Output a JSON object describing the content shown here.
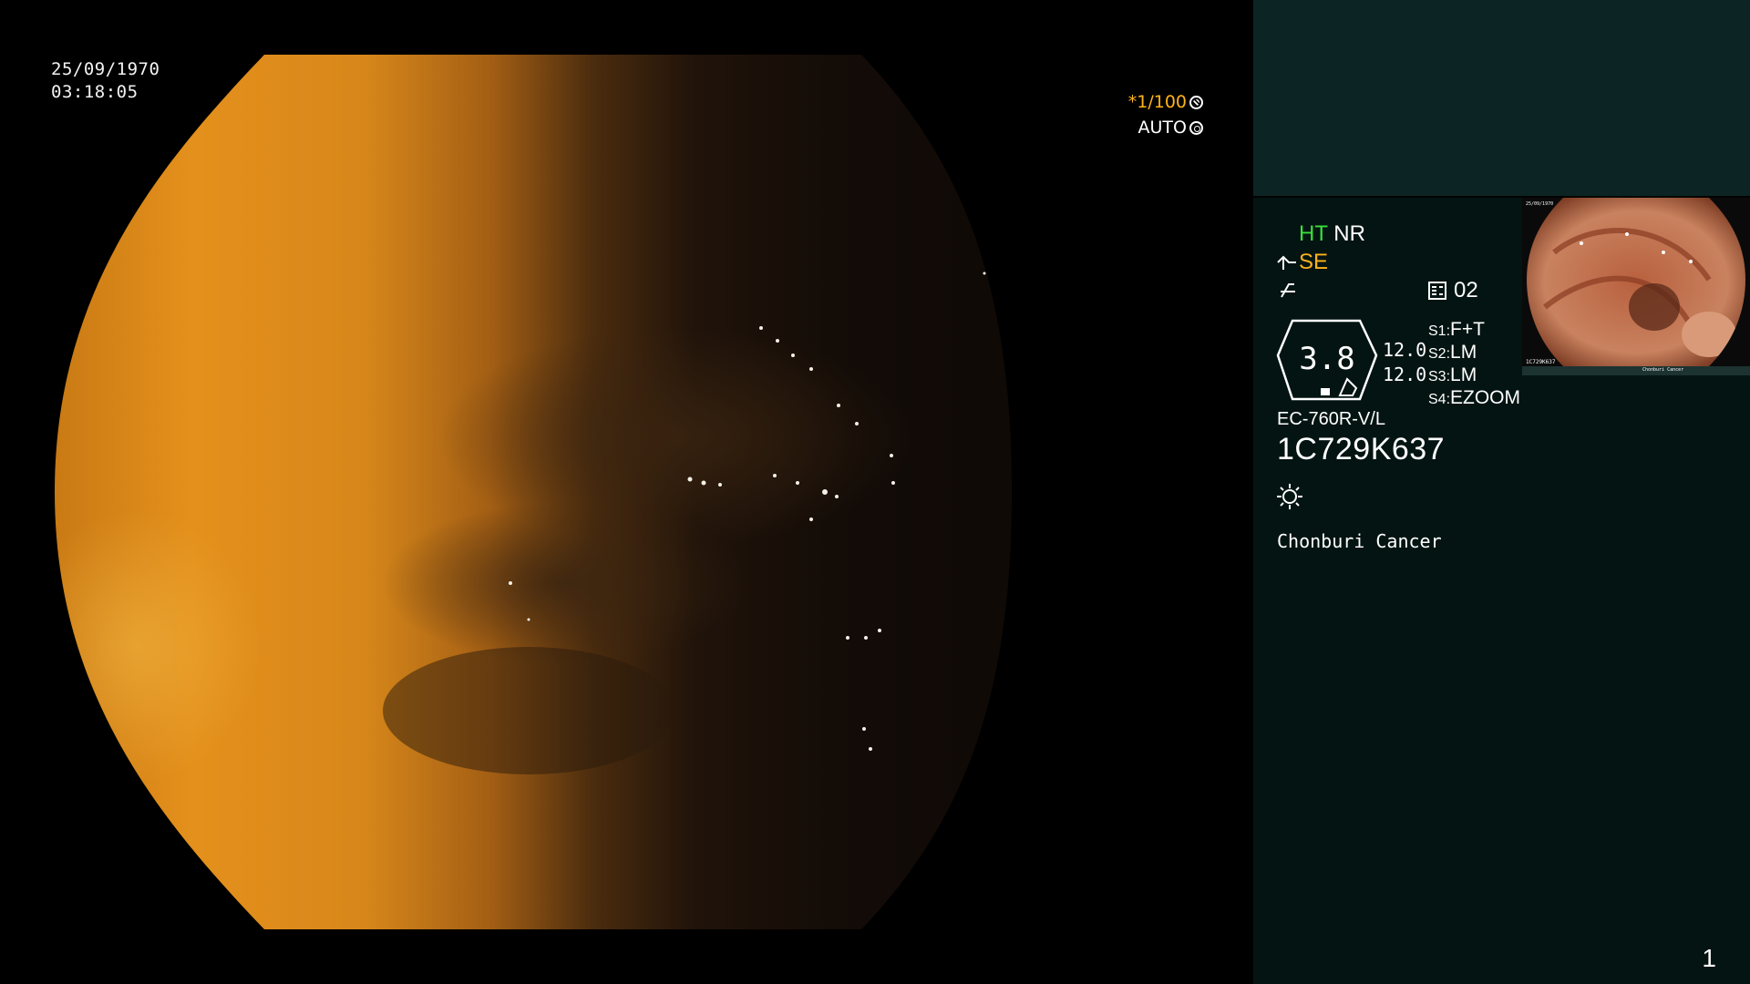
{
  "overlay": {
    "date": "25/09/1970",
    "time": "03:18:05",
    "shutter": "*1/100",
    "iris_mode": "AUTO",
    "page": "1"
  },
  "panel": {
    "ht": "HT",
    "nr": "NR",
    "se": "SE",
    "memory": "02",
    "magnification": "3.8",
    "setting_top": "12.0",
    "setting_bottom": "12.0",
    "presets": [
      {
        "key": "S1:",
        "value": "F+T"
      },
      {
        "key": "S2:",
        "value": "LM"
      },
      {
        "key": "S3:",
        "value": "LM"
      },
      {
        "key": "S4:",
        "value": "EZOOM"
      }
    ],
    "scope_model": "EC-760R-V/L",
    "scope_serial": "1C729K637",
    "hospital": "Chonburi Cancer"
  },
  "thumbnail_text": {
    "date": "25/09/1970",
    "serial": "1C729K637",
    "hospital": "Chonburi Cancer"
  },
  "colors": {
    "accent_orange": "#ffb21c",
    "accent_green": "#3adf3a",
    "panel_bg": "#031412",
    "panel_header": "#0c2524"
  },
  "icons": [
    "shutter-icon",
    "iris-icon",
    "scope-bend-icon",
    "freeze-icon",
    "memory-icon",
    "brightness-icon"
  ]
}
